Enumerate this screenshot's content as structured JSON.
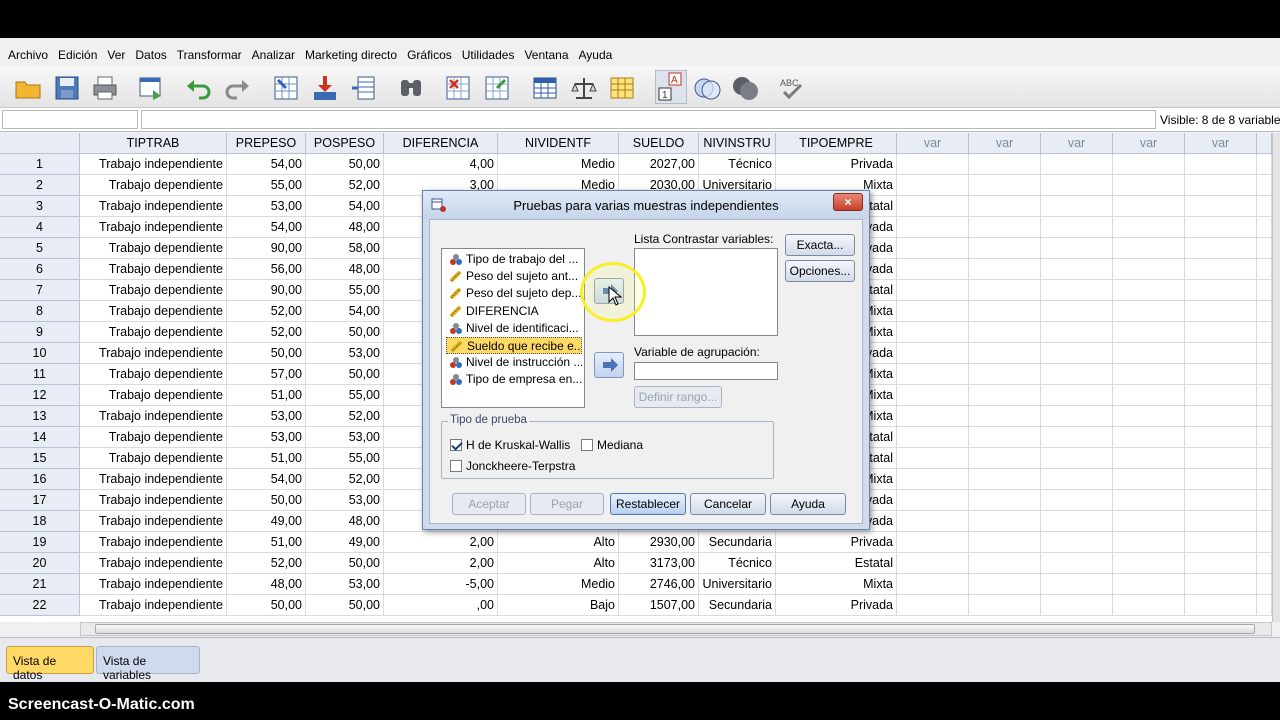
{
  "menu": [
    "Archivo",
    "Edición",
    "Ver",
    "Datos",
    "Transformar",
    "Analizar",
    "Marketing directo",
    "Gráficos",
    "Utilidades",
    "Ventana",
    "Ayuda"
  ],
  "status": {
    "visible": "Visible: 8 de 8 variable"
  },
  "columns": [
    "TIPTRAB",
    "PREPESO",
    "POSPESO",
    "DIFERENCIA",
    "NIVIDENTF",
    "SUELDO",
    "NIVINSTRU",
    "TIPOEMPRE",
    "var",
    "var",
    "var",
    "var",
    "var"
  ],
  "rows": [
    {
      "n": "1",
      "tiptrab": "Trabajo independiente",
      "prepeso": "54,00",
      "pospeso": "50,00",
      "dif": "4,00",
      "nividentf": "Medio",
      "sueldo": "2027,00",
      "nivinstru": "Técnico",
      "tipoempre": "Privada"
    },
    {
      "n": "2",
      "tiptrab": "Trabajo dependiente",
      "prepeso": "55,00",
      "pospeso": "52,00",
      "dif": "3,00",
      "nividentf": "Medio",
      "sueldo": "2030,00",
      "nivinstru": "Universitario",
      "tipoempre": "Mixta"
    },
    {
      "n": "3",
      "tiptrab": "Trabajo independiente",
      "prepeso": "53,00",
      "pospeso": "54,00",
      "dif": "",
      "nividentf": "",
      "sueldo": "",
      "nivinstru": "",
      "tipoempre": "tatal"
    },
    {
      "n": "4",
      "tiptrab": "Trabajo independiente",
      "prepeso": "54,00",
      "pospeso": "48,00",
      "dif": "",
      "nividentf": "",
      "sueldo": "",
      "nivinstru": "",
      "tipoempre": "vada"
    },
    {
      "n": "5",
      "tiptrab": "Trabajo dependiente",
      "prepeso": "90,00",
      "pospeso": "58,00",
      "dif": "",
      "nividentf": "",
      "sueldo": "",
      "nivinstru": "",
      "tipoempre": "vada"
    },
    {
      "n": "6",
      "tiptrab": "Trabajo dependiente",
      "prepeso": "56,00",
      "pospeso": "48,00",
      "dif": "",
      "nividentf": "",
      "sueldo": "",
      "nivinstru": "",
      "tipoempre": "vada"
    },
    {
      "n": "7",
      "tiptrab": "Trabajo dependiente",
      "prepeso": "90,00",
      "pospeso": "55,00",
      "dif": "",
      "nividentf": "",
      "sueldo": "",
      "nivinstru": "",
      "tipoempre": "tatal"
    },
    {
      "n": "8",
      "tiptrab": "Trabajo dependiente",
      "prepeso": "52,00",
      "pospeso": "54,00",
      "dif": "",
      "nividentf": "",
      "sueldo": "",
      "nivinstru": "",
      "tipoempre": "Mixta"
    },
    {
      "n": "9",
      "tiptrab": "Trabajo dependiente",
      "prepeso": "52,00",
      "pospeso": "50,00",
      "dif": "",
      "nividentf": "",
      "sueldo": "",
      "nivinstru": "",
      "tipoempre": "Mixta"
    },
    {
      "n": "10",
      "tiptrab": "Trabajo independiente",
      "prepeso": "50,00",
      "pospeso": "53,00",
      "dif": "",
      "nividentf": "",
      "sueldo": "",
      "nivinstru": "",
      "tipoempre": "vada"
    },
    {
      "n": "11",
      "tiptrab": "Trabajo dependiente",
      "prepeso": "57,00",
      "pospeso": "50,00",
      "dif": "",
      "nividentf": "",
      "sueldo": "",
      "nivinstru": "",
      "tipoempre": "Mixta"
    },
    {
      "n": "12",
      "tiptrab": "Trabajo dependiente",
      "prepeso": "51,00",
      "pospeso": "55,00",
      "dif": "",
      "nividentf": "",
      "sueldo": "",
      "nivinstru": "",
      "tipoempre": "Mixta"
    },
    {
      "n": "13",
      "tiptrab": "Trabajo independiente",
      "prepeso": "53,00",
      "pospeso": "52,00",
      "dif": "",
      "nividentf": "",
      "sueldo": "",
      "nivinstru": "",
      "tipoempre": "Mixta"
    },
    {
      "n": "14",
      "tiptrab": "Trabajo dependiente",
      "prepeso": "53,00",
      "pospeso": "53,00",
      "dif": "",
      "nividentf": "",
      "sueldo": "",
      "nivinstru": "",
      "tipoempre": "tatal"
    },
    {
      "n": "15",
      "tiptrab": "Trabajo dependiente",
      "prepeso": "51,00",
      "pospeso": "55,00",
      "dif": "",
      "nividentf": "",
      "sueldo": "",
      "nivinstru": "",
      "tipoempre": "tatal"
    },
    {
      "n": "16",
      "tiptrab": "Trabajo independiente",
      "prepeso": "54,00",
      "pospeso": "52,00",
      "dif": "",
      "nividentf": "",
      "sueldo": "",
      "nivinstru": "",
      "tipoempre": "Mixta"
    },
    {
      "n": "17",
      "tiptrab": "Trabajo independiente",
      "prepeso": "50,00",
      "pospeso": "53,00",
      "dif": "",
      "nividentf": "",
      "sueldo": "",
      "nivinstru": "",
      "tipoempre": "vada"
    },
    {
      "n": "18",
      "tiptrab": "Trabajo independiente",
      "prepeso": "49,00",
      "pospeso": "48,00",
      "dif": "",
      "nividentf": "",
      "sueldo": "",
      "nivinstru": "",
      "tipoempre": "vada"
    },
    {
      "n": "19",
      "tiptrab": "Trabajo independiente",
      "prepeso": "51,00",
      "pospeso": "49,00",
      "dif": "2,00",
      "nividentf": "Alto",
      "sueldo": "2930,00",
      "nivinstru": "Secundaria",
      "tipoempre": "Privada"
    },
    {
      "n": "20",
      "tiptrab": "Trabajo independiente",
      "prepeso": "52,00",
      "pospeso": "50,00",
      "dif": "2,00",
      "nividentf": "Alto",
      "sueldo": "3173,00",
      "nivinstru": "Técnico",
      "tipoempre": "Estatal"
    },
    {
      "n": "21",
      "tiptrab": "Trabajo independiente",
      "prepeso": "48,00",
      "pospeso": "53,00",
      "dif": "-5,00",
      "nividentf": "Medio",
      "sueldo": "2746,00",
      "nivinstru": "Universitario",
      "tipoempre": "Mixta"
    },
    {
      "n": "22",
      "tiptrab": "Trabajo independiente",
      "prepeso": "50,00",
      "pospeso": "50,00",
      "dif": ",00",
      "nividentf": "Bajo",
      "sueldo": "1507,00",
      "nivinstru": "Secundaria",
      "tipoempre": "Privada"
    }
  ],
  "dialog": {
    "title": "Pruebas para varias muestras independientes",
    "close": "×",
    "variables": [
      {
        "label": "Tipo de trabajo del ...",
        "icon": "nominal-icon",
        "selected": false
      },
      {
        "label": "Peso del sujeto ant...",
        "icon": "scale-icon",
        "selected": false
      },
      {
        "label": "Peso del sujeto dep...",
        "icon": "scale-icon",
        "selected": false
      },
      {
        "label": "DIFERENCIA",
        "icon": "scale-icon",
        "selected": false
      },
      {
        "label": "Nivel de identificaci...",
        "icon": "nominal-icon",
        "selected": false
      },
      {
        "label": "Sueldo que recibe e...",
        "icon": "scale-icon",
        "selected": true
      },
      {
        "label": "Nivel de instrucción ...",
        "icon": "nominal-icon",
        "selected": false
      },
      {
        "label": "Tipo de empresa en...",
        "icon": "nominal-icon",
        "selected": false
      }
    ],
    "test_list_label": "Lista Contrastar variables:",
    "group_var_label": "Variable de agrupación:",
    "define_range": "Definir rango...",
    "exact": "Exacta...",
    "options": "Opciones...",
    "test_type_legend": "Tipo de prueba",
    "kruskal": "H de Kruskal-Wallis",
    "mediana": "Mediana",
    "jonckheere": "Jonckheere-Terpstra",
    "accept": "Aceptar",
    "paste": "Pegar",
    "reset": "Restablecer",
    "cancel": "Cancelar",
    "help": "Ayuda"
  },
  "tabs": {
    "data_view": "Vista de datos",
    "variable_view": "Vista de variables"
  },
  "watermark": "Screencast-O-Matic.com",
  "colors": {
    "selection": "#ffd966",
    "header_bg": "#e8edf5",
    "dialog_bg": "#cfdcee"
  }
}
